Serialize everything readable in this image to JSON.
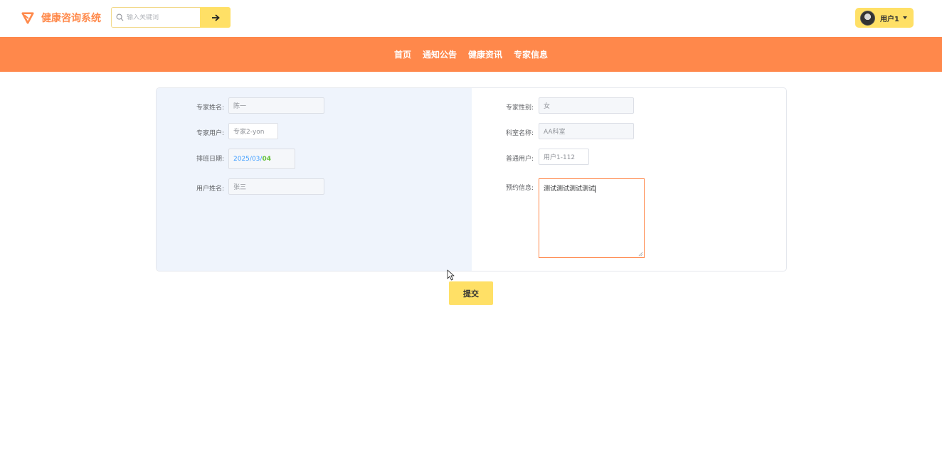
{
  "header": {
    "title": "健康咨询系统",
    "search_placeholder": "输入关键词",
    "user_name": "用户1",
    "brand_color": "#ff884b",
    "accent_color": "#ffe066"
  },
  "nav": {
    "items": [
      {
        "label": "首页"
      },
      {
        "label": "通知公告"
      },
      {
        "label": "健康资讯"
      },
      {
        "label": "专家信息"
      }
    ]
  },
  "form": {
    "expert_name": {
      "label": "专家姓名:",
      "value": "陈一"
    },
    "expert_user": {
      "label": "专家用户:",
      "value": "专家2-yon"
    },
    "schedule_date": {
      "label": "排班日期:",
      "year": "2025",
      "month": "03",
      "day": "04",
      "sep": "/"
    },
    "user_realname": {
      "label": "用户姓名:",
      "value": "张三"
    },
    "expert_gender": {
      "label": "专家性别:",
      "value": "女"
    },
    "department": {
      "label": "科室名称:",
      "value": "AA科室"
    },
    "normal_user": {
      "label": "普通用户:",
      "value": "用户1-112"
    },
    "appointment_info": {
      "label": "预约信息:",
      "value": "测试测试测试测试"
    }
  },
  "submit_label": "提交"
}
